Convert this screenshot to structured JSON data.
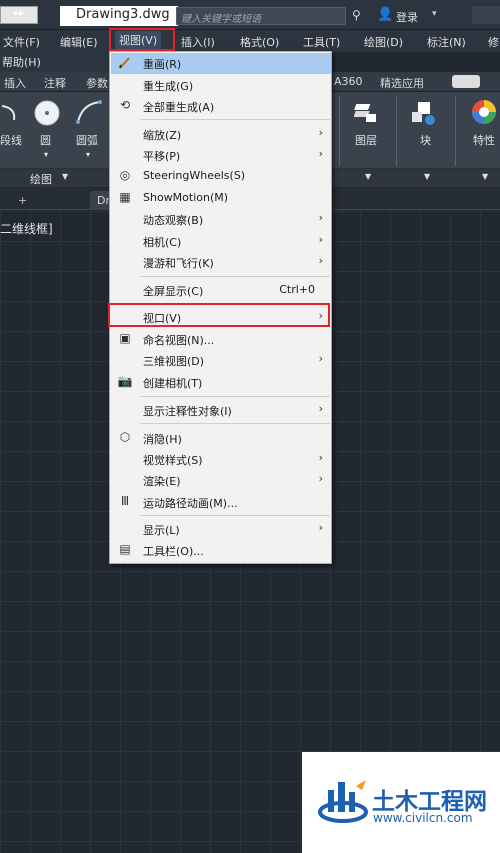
{
  "titlebar": {
    "doc_title": "Drawing3.dwg",
    "search_placeholder": "键入关键字或短语",
    "login": "登录"
  },
  "menubar": {
    "items": [
      "文件(F)",
      "编辑(E)",
      "视图(V)",
      "插入(I)",
      "格式(O)",
      "工具(T)",
      "绘图(D)",
      "标注(N)",
      "修"
    ],
    "row2": "帮助(H)"
  },
  "ribbon_tabs": [
    "插入",
    "注释",
    "参数",
    "A360",
    "精选应用"
  ],
  "ribbon": {
    "tools": [
      "段线",
      "圆",
      "圆弧",
      "图层",
      "块",
      "特性"
    ],
    "panel_title": "绘图"
  },
  "filetabs": {
    "doc_tab": "Dr",
    "viewport_label": "二维线框]"
  },
  "menu": {
    "items": [
      {
        "label": "重画(R)",
        "icon": "pencil-icon",
        "highlight": true
      },
      {
        "label": "重生成(G)"
      },
      {
        "label": "全部重生成(A)",
        "icon": "regen-icon"
      },
      {
        "label": "缩放(Z)",
        "submenu": true
      },
      {
        "label": "平移(P)",
        "submenu": true
      },
      {
        "label": "SteeringWheels(S)",
        "icon": "wheel-icon"
      },
      {
        "label": "ShowMotion(M)",
        "icon": "showmotion-icon"
      },
      {
        "label": "动态观察(B)",
        "submenu": true
      },
      {
        "label": "相机(C)",
        "submenu": true
      },
      {
        "label": "漫游和飞行(K)",
        "submenu": true
      },
      {
        "label": "全屏显示(C)",
        "shortcut": "Ctrl+0"
      },
      {
        "label": "视口(V)",
        "submenu": true
      },
      {
        "label": "命名视图(N)...",
        "icon": "named-view-icon"
      },
      {
        "label": "三维视图(D)",
        "submenu": true
      },
      {
        "label": "创建相机(T)",
        "icon": "camera-icon"
      },
      {
        "label": "显示注释性对象(I)",
        "submenu": true
      },
      {
        "label": "消隐(H)",
        "icon": "hide-icon"
      },
      {
        "label": "视觉样式(S)",
        "submenu": true
      },
      {
        "label": "渲染(E)",
        "submenu": true
      },
      {
        "label": "运动路径动画(M)...",
        "icon": "motion-path-icon"
      },
      {
        "label": "显示(L)",
        "submenu": true
      },
      {
        "label": "工具栏(O)...",
        "icon": "toolbar-icon"
      }
    ]
  },
  "watermark": {
    "title": "土木工程网",
    "url": "www.civilcn.com"
  },
  "colors": {
    "highlight_border": "#e2232b",
    "menu_highlight": "#a8cbef",
    "canvas": "#212832"
  }
}
